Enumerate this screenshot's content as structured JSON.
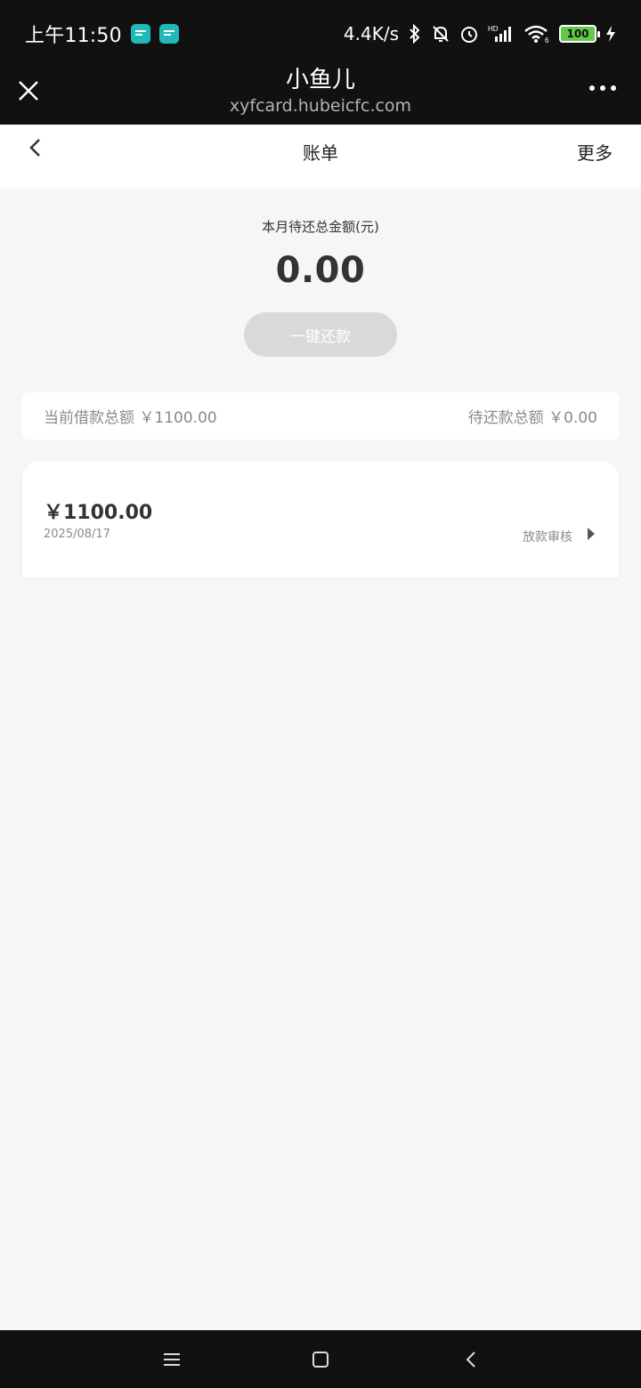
{
  "statusbar": {
    "time": "上午11:50",
    "network_speed": "4.4K/s",
    "hd_label": "HD",
    "wifi_label": "6",
    "battery": "100"
  },
  "appbar": {
    "title": "小鱼儿",
    "subtitle": "xyfcard.hubeicfc.com"
  },
  "page": {
    "title": "账单",
    "more_label": "更多"
  },
  "summary": {
    "label": "本月待还总金额(元)",
    "amount": "0.00",
    "repay_button": "一键还款"
  },
  "totals": {
    "current_loan_label": "当前借款总额",
    "current_loan_value": "￥1100.00",
    "pending_label": "待还款总额",
    "pending_value": "￥0.00"
  },
  "loans": [
    {
      "amount": "￥1100.00",
      "date": "2025/08/17",
      "status": "放款审核"
    }
  ],
  "icons": [
    "close-icon",
    "more-icon",
    "back-icon",
    "chevron-right-icon",
    "menu-icon",
    "home-icon",
    "nav-back-icon"
  ],
  "colors": {
    "bar": "#111111",
    "background": "#f5f6f8",
    "button_disabled": "#d9d9d9",
    "battery": "#62c84a",
    "notif": "#1fb9b9"
  }
}
